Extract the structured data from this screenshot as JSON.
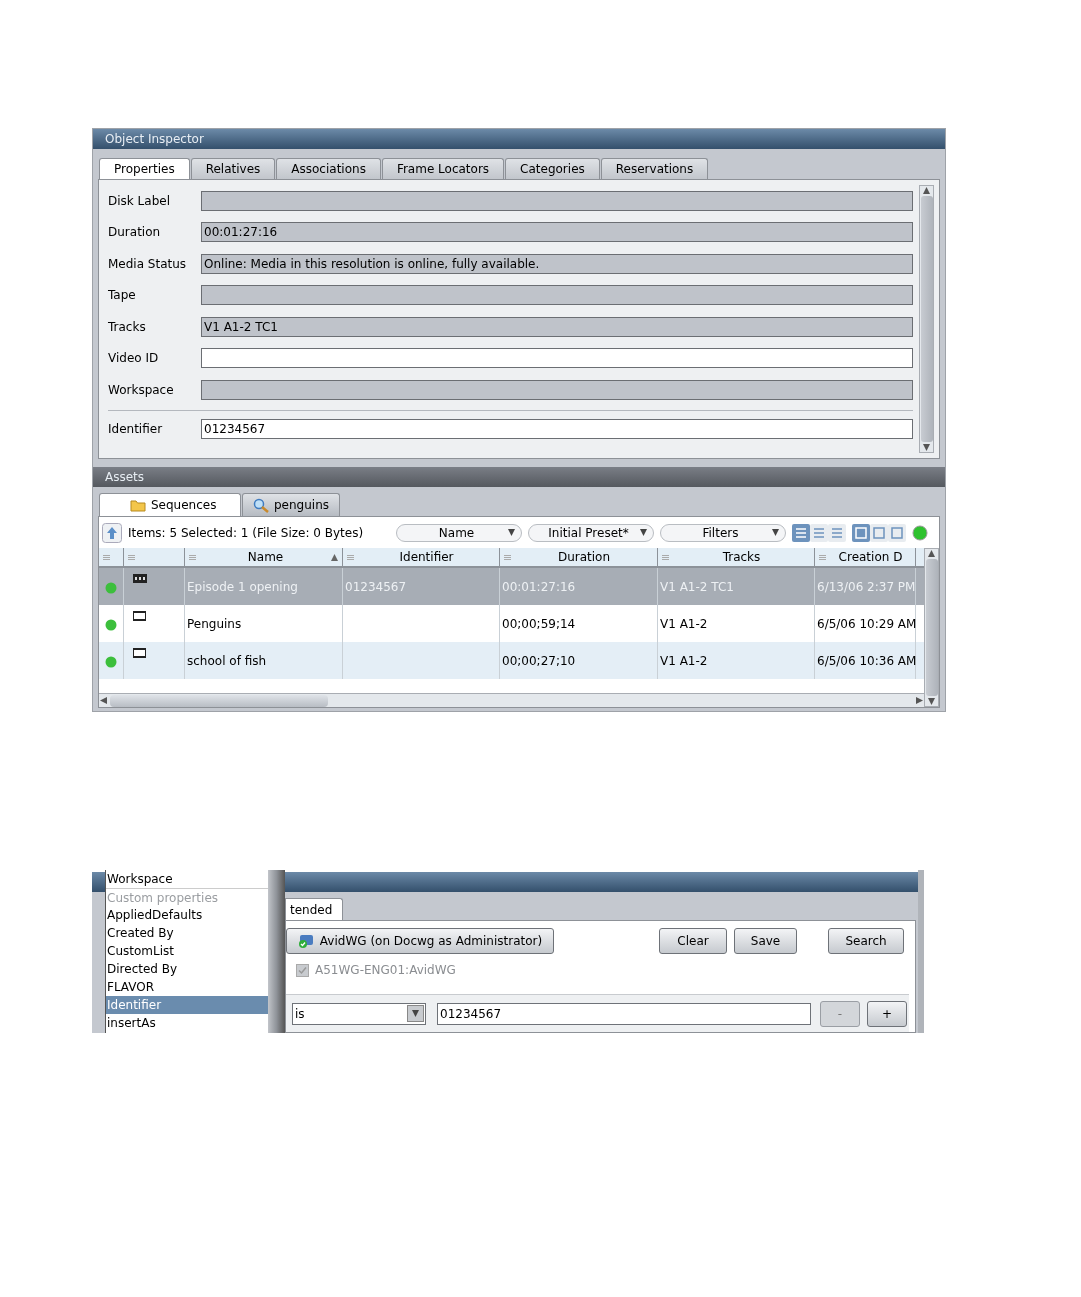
{
  "inspector": {
    "title": "Object Inspector",
    "tabs": [
      {
        "label": "Properties",
        "selected": true
      },
      {
        "label": "Relatives",
        "selected": false
      },
      {
        "label": "Associations",
        "selected": false
      },
      {
        "label": "Frame Locators",
        "selected": false
      },
      {
        "label": "Categories",
        "selected": false
      },
      {
        "label": "Reservations",
        "selected": false
      }
    ],
    "fields": [
      {
        "label": "Disk Label",
        "editable": false
      },
      {
        "label": "Duration",
        "value": "00:01:27:16",
        "editable": false
      },
      {
        "label": "Media Status",
        "value": "Online: Media in this resolution is online, fully available.",
        "editable": false
      },
      {
        "label": "Tape",
        "editable": false
      },
      {
        "label": "Tracks",
        "value": "V1 A1-2 TC1",
        "editable": false
      },
      {
        "label": "Video ID",
        "editable": true
      },
      {
        "label": "Workspace",
        "editable": false
      }
    ],
    "custom_fields": [
      {
        "label": "Identifier",
        "value": "01234567",
        "editable": true
      }
    ]
  },
  "assets": {
    "title": "Assets",
    "tabs": [
      {
        "label": "Sequences",
        "kind": "folder",
        "selected": true
      },
      {
        "label": "penguins",
        "kind": "search",
        "selected": false
      }
    ],
    "status": "Items: 5 Selected: 1 (File Size: 0 Bytes)",
    "dropdowns": [
      "Name",
      "Initial Preset*",
      "Filters"
    ],
    "view_buttons": [
      {
        "selected": true
      },
      {
        "selected": false
      },
      {
        "selected": false
      }
    ],
    "size_buttons": [
      {
        "selected": true
      },
      {
        "selected": false
      },
      {
        "selected": false
      }
    ],
    "columns": [
      "",
      "",
      "Name",
      "Identifier",
      "Duration",
      "Tracks",
      "Creation D"
    ],
    "rows": [
      {
        "selected": true,
        "kind": "sequence",
        "name": "Episode 1 opening",
        "identifier": "01234567",
        "duration": "00:01:27:16",
        "tracks": "V1 A1-2 TC1",
        "created": "6/13/06 2:37 PM"
      },
      {
        "selected": false,
        "kind": "clip",
        "name": "Penguins",
        "duration": "00;00;59;14",
        "tracks": "V1 A1-2",
        "created": "6/5/06 10:29 AM"
      },
      {
        "selected": false,
        "kind": "clip",
        "name": "school of fish",
        "duration": "00;00;27;10",
        "tracks": "V1 A1-2",
        "created": "6/5/06 10:36 AM"
      }
    ]
  },
  "search": {
    "tab": "tended",
    "workgroup_button": "AvidWG (on Docwg as Administrator)",
    "buttons": [
      "Clear",
      "Save",
      "Search"
    ],
    "workgroup": {
      "label": "A51WG-ENG01:AvidWG",
      "checked": true,
      "disabled": true
    },
    "operator": "is",
    "value": "01234567",
    "row_buttons": [
      {
        "label": "-",
        "disabled": true
      },
      {
        "label": "+",
        "disabled": false
      }
    ],
    "property_list": [
      {
        "label": "Workspace",
        "kind": "item",
        "selected": false
      },
      {
        "label": "Custom properties",
        "kind": "header",
        "selected": false
      },
      {
        "label": "AppliedDefaults",
        "kind": "item",
        "selected": false
      },
      {
        "label": "Created By",
        "kind": "item",
        "selected": false
      },
      {
        "label": "CustomList",
        "kind": "item",
        "selected": false
      },
      {
        "label": "Directed By",
        "kind": "item",
        "selected": false
      },
      {
        "label": "FLAVOR",
        "kind": "item",
        "selected": false
      },
      {
        "label": "Identifier",
        "kind": "item",
        "selected": true
      },
      {
        "label": "insertAs",
        "kind": "item",
        "selected": false
      }
    ]
  }
}
